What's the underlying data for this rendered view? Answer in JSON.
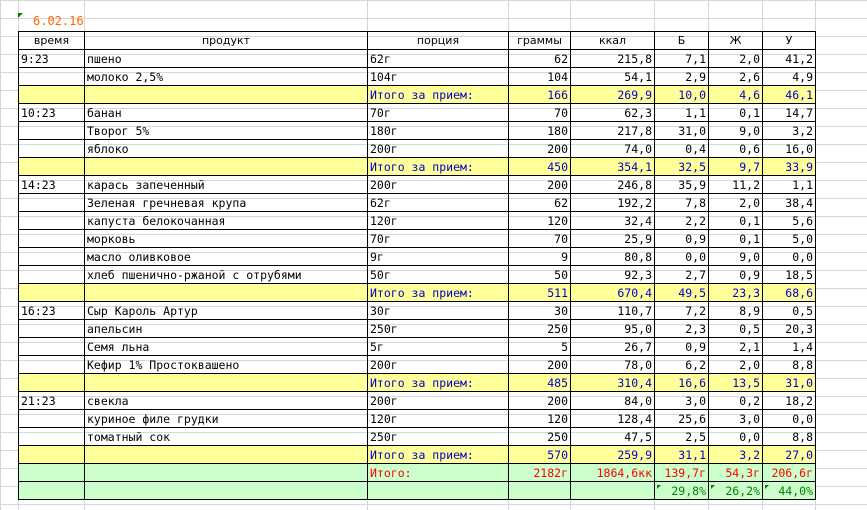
{
  "sheet": {
    "date": "6.02.16"
  },
  "headers": [
    "время",
    "продукт",
    "порция",
    "граммы",
    "ккал",
    "Б",
    "Ж",
    "У"
  ],
  "rows": [
    {
      "type": "item",
      "time": "9:23",
      "product": "пшено",
      "portion": "62г",
      "grams": "62",
      "kcal": "215,8",
      "b": "7,1",
      "zh": "2,0",
      "u": "41,2"
    },
    {
      "type": "item",
      "time": "",
      "product": "молоко 2,5%",
      "portion": "104г",
      "grams": "104",
      "kcal": "54,1",
      "b": "2,9",
      "zh": "2,6",
      "u": "4,9"
    },
    {
      "type": "subtotal",
      "time": "",
      "product": "",
      "portion": "Итого за прием:",
      "grams": "166",
      "kcal": "269,9",
      "b": "10,0",
      "zh": "4,6",
      "u": "46,1"
    },
    {
      "type": "item",
      "time": "10:23",
      "product": "банан",
      "portion": "70г",
      "grams": "70",
      "kcal": "62,3",
      "b": "1,1",
      "zh": "0,1",
      "u": "14,7"
    },
    {
      "type": "item",
      "time": "",
      "product": "Творог 5%",
      "portion": "180г",
      "grams": "180",
      "kcal": "217,8",
      "b": "31,0",
      "zh": "9,0",
      "u": "3,2"
    },
    {
      "type": "item",
      "time": "",
      "product": "яблоко",
      "portion": "200г",
      "grams": "200",
      "kcal": "74,0",
      "b": "0,4",
      "zh": "0,6",
      "u": "16,0"
    },
    {
      "type": "subtotal",
      "time": "",
      "product": "",
      "portion": "Итого за прием:",
      "grams": "450",
      "kcal": "354,1",
      "b": "32,5",
      "zh": "9,7",
      "u": "33,9"
    },
    {
      "type": "item",
      "time": "14:23",
      "product": "карась запеченный",
      "portion": "200г",
      "grams": "200",
      "kcal": "246,8",
      "b": "35,9",
      "zh": "11,2",
      "u": "1,1"
    },
    {
      "type": "item",
      "time": "",
      "product": "Зеленая гречневая крупа",
      "portion": "62г",
      "grams": "62",
      "kcal": "192,2",
      "b": "7,8",
      "zh": "2,0",
      "u": "38,4"
    },
    {
      "type": "item",
      "time": "",
      "product": "капуста белокочанная",
      "portion": "120г",
      "grams": "120",
      "kcal": "32,4",
      "b": "2,2",
      "zh": "0,1",
      "u": "5,6"
    },
    {
      "type": "item",
      "time": "",
      "product": "морковь",
      "portion": "70г",
      "grams": "70",
      "kcal": "25,9",
      "b": "0,9",
      "zh": "0,1",
      "u": "5,0"
    },
    {
      "type": "item",
      "time": "",
      "product": "масло оливковое",
      "portion": "9г",
      "grams": "9",
      "kcal": "80,8",
      "b": "0,0",
      "zh": "9,0",
      "u": "0,0"
    },
    {
      "type": "item",
      "time": "",
      "product": "хлеб пшенично-ржаной с отрубями",
      "portion": "50г",
      "grams": "50",
      "kcal": "92,3",
      "b": "2,7",
      "zh": "0,9",
      "u": "18,5"
    },
    {
      "type": "subtotal",
      "time": "",
      "product": "",
      "portion": "Итого за прием:",
      "grams": "511",
      "kcal": "670,4",
      "b": "49,5",
      "zh": "23,3",
      "u": "68,6"
    },
    {
      "type": "item",
      "time": "16:23",
      "product": "Сыр Кароль Артур",
      "portion": "30г",
      "grams": "30",
      "kcal": "110,7",
      "b": "7,2",
      "zh": "8,9",
      "u": "0,5"
    },
    {
      "type": "item",
      "time": "",
      "product": "апельсин",
      "portion": "250г",
      "grams": "250",
      "kcal": "95,0",
      "b": "2,3",
      "zh": "0,5",
      "u": "20,3"
    },
    {
      "type": "item",
      "time": "",
      "product": "Семя льна",
      "portion": "5г",
      "grams": "5",
      "kcal": "26,7",
      "b": "0,9",
      "zh": "2,1",
      "u": "1,4"
    },
    {
      "type": "item",
      "time": "",
      "product": "Кефир 1% Простоквашено",
      "portion": "200г",
      "grams": "200",
      "kcal": "78,0",
      "b": "6,2",
      "zh": "2,0",
      "u": "8,8"
    },
    {
      "type": "subtotal",
      "time": "",
      "product": "",
      "portion": "Итого за прием:",
      "grams": "485",
      "kcal": "310,4",
      "b": "16,6",
      "zh": "13,5",
      "u": "31,0"
    },
    {
      "type": "item",
      "time": "21:23",
      "product": "свекла",
      "portion": "200г",
      "grams": "200",
      "kcal": "84,0",
      "b": "3,0",
      "zh": "0,2",
      "u": "18,2"
    },
    {
      "type": "item",
      "time": "",
      "product": "куриное филе грудки",
      "portion": "120г",
      "grams": "120",
      "kcal": "128,4",
      "b": "25,6",
      "zh": "3,0",
      "u": "0,0"
    },
    {
      "type": "item",
      "time": "",
      "product": "томатный сок",
      "portion": "250г",
      "grams": "250",
      "kcal": "47,5",
      "b": "2,5",
      "zh": "0,0",
      "u": "8,8"
    },
    {
      "type": "subtotal",
      "time": "",
      "product": "",
      "portion": "Итого за прием:",
      "grams": "570",
      "kcal": "259,9",
      "b": "31,1",
      "zh": "3,2",
      "u": "27,0"
    }
  ],
  "total": {
    "portion": "Итого:",
    "grams": "2182г",
    "kcal": "1864,6кк",
    "b": "139,7г",
    "zh": "54,3г",
    "u": "206,6г"
  },
  "percent": {
    "b": "29,8%",
    "zh": "26,2%",
    "u": "44,0%"
  }
}
